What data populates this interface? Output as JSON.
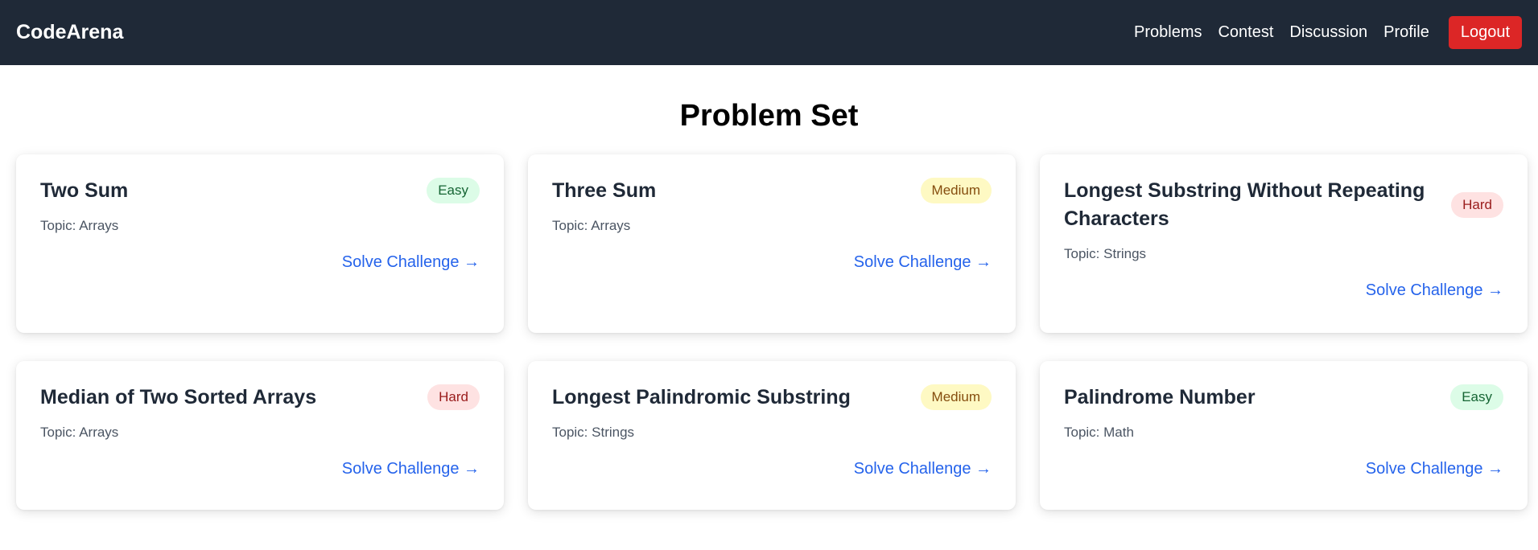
{
  "brand": "CodeArena",
  "nav": {
    "links": [
      "Problems",
      "Contest",
      "Discussion",
      "Profile"
    ],
    "logout": "Logout"
  },
  "page_title": "Problem Set",
  "solve_label": "Solve Challenge →",
  "colors": {
    "navbar": "#1f2937",
    "logout": "#dc2626",
    "link": "#2563eb",
    "easy_bg": "#dcfce7",
    "medium_bg": "#fef9c3",
    "hard_bg": "#fee2e2"
  },
  "problems": [
    {
      "title": "Two Sum",
      "difficulty": "Easy",
      "topic": "Topic: Arrays"
    },
    {
      "title": "Three Sum",
      "difficulty": "Medium",
      "topic": "Topic: Arrays"
    },
    {
      "title": "Longest Substring Without Repeating Characters",
      "difficulty": "Hard",
      "topic": "Topic: Strings"
    },
    {
      "title": "Median of Two Sorted Arrays",
      "difficulty": "Hard",
      "topic": "Topic: Arrays"
    },
    {
      "title": "Longest Palindromic Substring",
      "difficulty": "Medium",
      "topic": "Topic: Strings"
    },
    {
      "title": "Palindrome Number",
      "difficulty": "Easy",
      "topic": "Topic: Math"
    }
  ]
}
